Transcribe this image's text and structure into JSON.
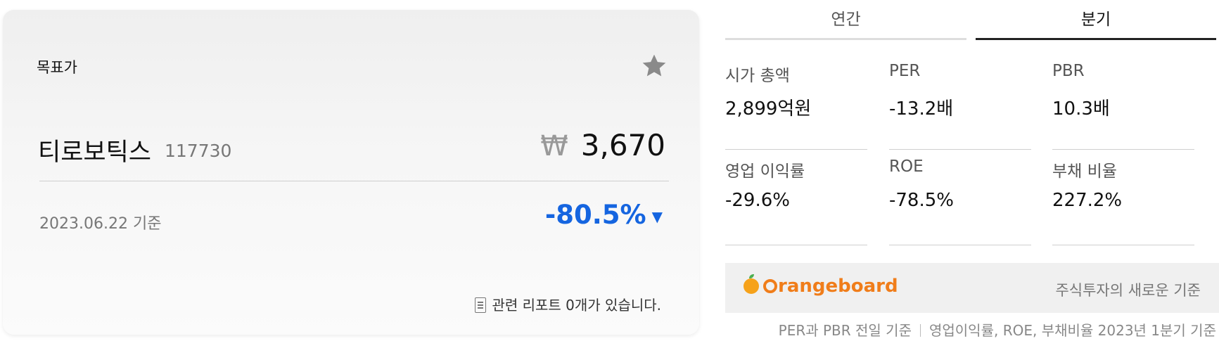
{
  "card": {
    "title": "목표가",
    "stock_name": "티로보틱스",
    "stock_code": "117730",
    "currency_symbol": "₩",
    "price": "3,670",
    "date": "2023.06.22 기준",
    "change": "-80.5%",
    "change_color": "#1565e0",
    "report_text": "관련 리포트 0개가 있습니다."
  },
  "tabs": [
    {
      "label": "연간",
      "active": false
    },
    {
      "label": "분기",
      "active": true
    }
  ],
  "metrics": [
    {
      "label": "시가 총액",
      "value": "2,899억원"
    },
    {
      "label": "PER",
      "value": "-13.2배"
    },
    {
      "label": "PBR",
      "value": "10.3배"
    },
    {
      "label": "영업 이익률",
      "value": "-29.6%"
    },
    {
      "label": "ROE",
      "value": "-78.5%"
    },
    {
      "label": "부채 비율",
      "value": "227.2%"
    }
  ],
  "banner": {
    "brand_rest": "rangeboard",
    "brand_color": "#f07d1a",
    "tagline": "주식투자의 새로운 기준"
  },
  "footnote": {
    "left": "PER과 PBR 전일 기준",
    "right": "영업이익률, ROE, 부채비율 2023년 1분기 기준"
  }
}
